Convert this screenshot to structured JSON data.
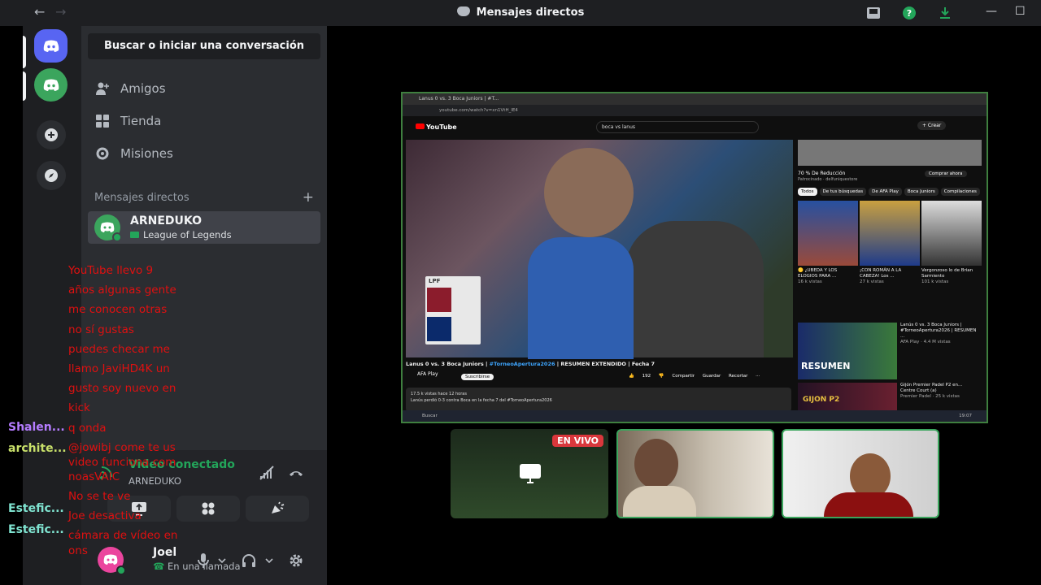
{
  "window": {
    "title": "Mensajes directos",
    "back_glyph": "←",
    "forward_glyph": "→",
    "minimize_glyph": "—",
    "maximize_glyph": "☐"
  },
  "sidebar": {
    "search_label": "Buscar o iniciar una conversación",
    "nav": [
      {
        "label": "Amigos",
        "icon": "friends-icon"
      },
      {
        "label": "Tienda",
        "icon": "shop-icon"
      },
      {
        "label": "Misiones",
        "icon": "quests-icon"
      }
    ],
    "dm_header": "Mensajes directos",
    "dm_add_glyph": "+",
    "dm": {
      "name": "ARNEDUKO",
      "activity": "League of Legends"
    }
  },
  "voice_panel": {
    "status": "Video conectado",
    "channel": "ARNEDUKO"
  },
  "user_panel": {
    "name": "Joel",
    "status": "En una llamada"
  },
  "shared_screen": {
    "tab_title": "Lanus 0 vs. 3 Boca Juniors | #T...",
    "url": "youtube.com/watch?v=xn1VtH_IE4",
    "yt_logo": "YouTube",
    "search_query": "boca vs lanus",
    "create_label": "+ Crear",
    "video_title_prefix": "Lanus 0 vs. 3 Boca Juniors | ",
    "video_title_hashtag": "#TorneoApertura2026",
    "video_title_suffix": " | RESUMEN EXTENDIDO | Fecha 7",
    "channel_name": "AFA Play",
    "subscribe_label": "Suscribirse",
    "actions": "👍 192  👎  Compartir  Guardar  Recortar  ···",
    "description_line1": "17.5 k vistas hace 12 horas",
    "description_line2": "Lanús perdió 0-3 contra Boca en la fecha 7 del #TorneoApertura2026",
    "taskbar_search": "Buscar",
    "taskbar_time": "19:07",
    "lpf_label": "LPF",
    "ad_title": "70 % De Reducción",
    "ad_sub": "Patrocinado · delfuniquestore",
    "ad_button": "Comprar ahora",
    "chips": [
      "Todos",
      "De tus búsquedas",
      "De AFA Play",
      "Boca Juniors",
      "Compilaciones"
    ],
    "thumbs": [
      {
        "caption": "🟡 ¿UBEDA Y LOS ELOGIOS PARA ...",
        "views": "16 k vistas"
      },
      {
        "caption": "¡CON ROMÁN A LA CABEZA! Los ...",
        "views": "27 k vistas"
      },
      {
        "caption": "Vergonzoso lo de Brian Sarmiento",
        "views": "101 k vistas"
      }
    ],
    "recs": [
      {
        "title": "Lanús 0 vs. 3 Boca Juniors | #TorneoApertura2026 | RESUMEN ...",
        "meta": "AFA Play · 4.4 M vistas",
        "thumb_text": "RESUMEN"
      },
      {
        "title": "Gijón Premier Padel P2 en... Centre Court (a)",
        "meta": "Premier Padel · 25 k vistas",
        "thumb_text": "GIJON P2"
      }
    ]
  },
  "tiles": [
    {
      "label": "EN VIVO"
    }
  ],
  "chat_overlay": {
    "message": [
      "YouTube llevo 9",
      "años algunas gente",
      "me conocen otras",
      "no sí gustas",
      "puedes checar me",
      "llamo JaviHD4K un",
      "gusto soy nuevo en",
      "kick",
      "q onda",
      "@jowibj come te us",
      "video funciona com",
      "noasVAIC",
      "No se te ve",
      "Joe desactiva",
      "cámara de vídeo en",
      "ons"
    ],
    "names": [
      "Shalen...",
      "archite...",
      "Estefic...",
      "Estefic..."
    ]
  },
  "colors": {
    "accent": "#5865f2",
    "green": "#23a55a",
    "overlay_red": "#e01010"
  }
}
